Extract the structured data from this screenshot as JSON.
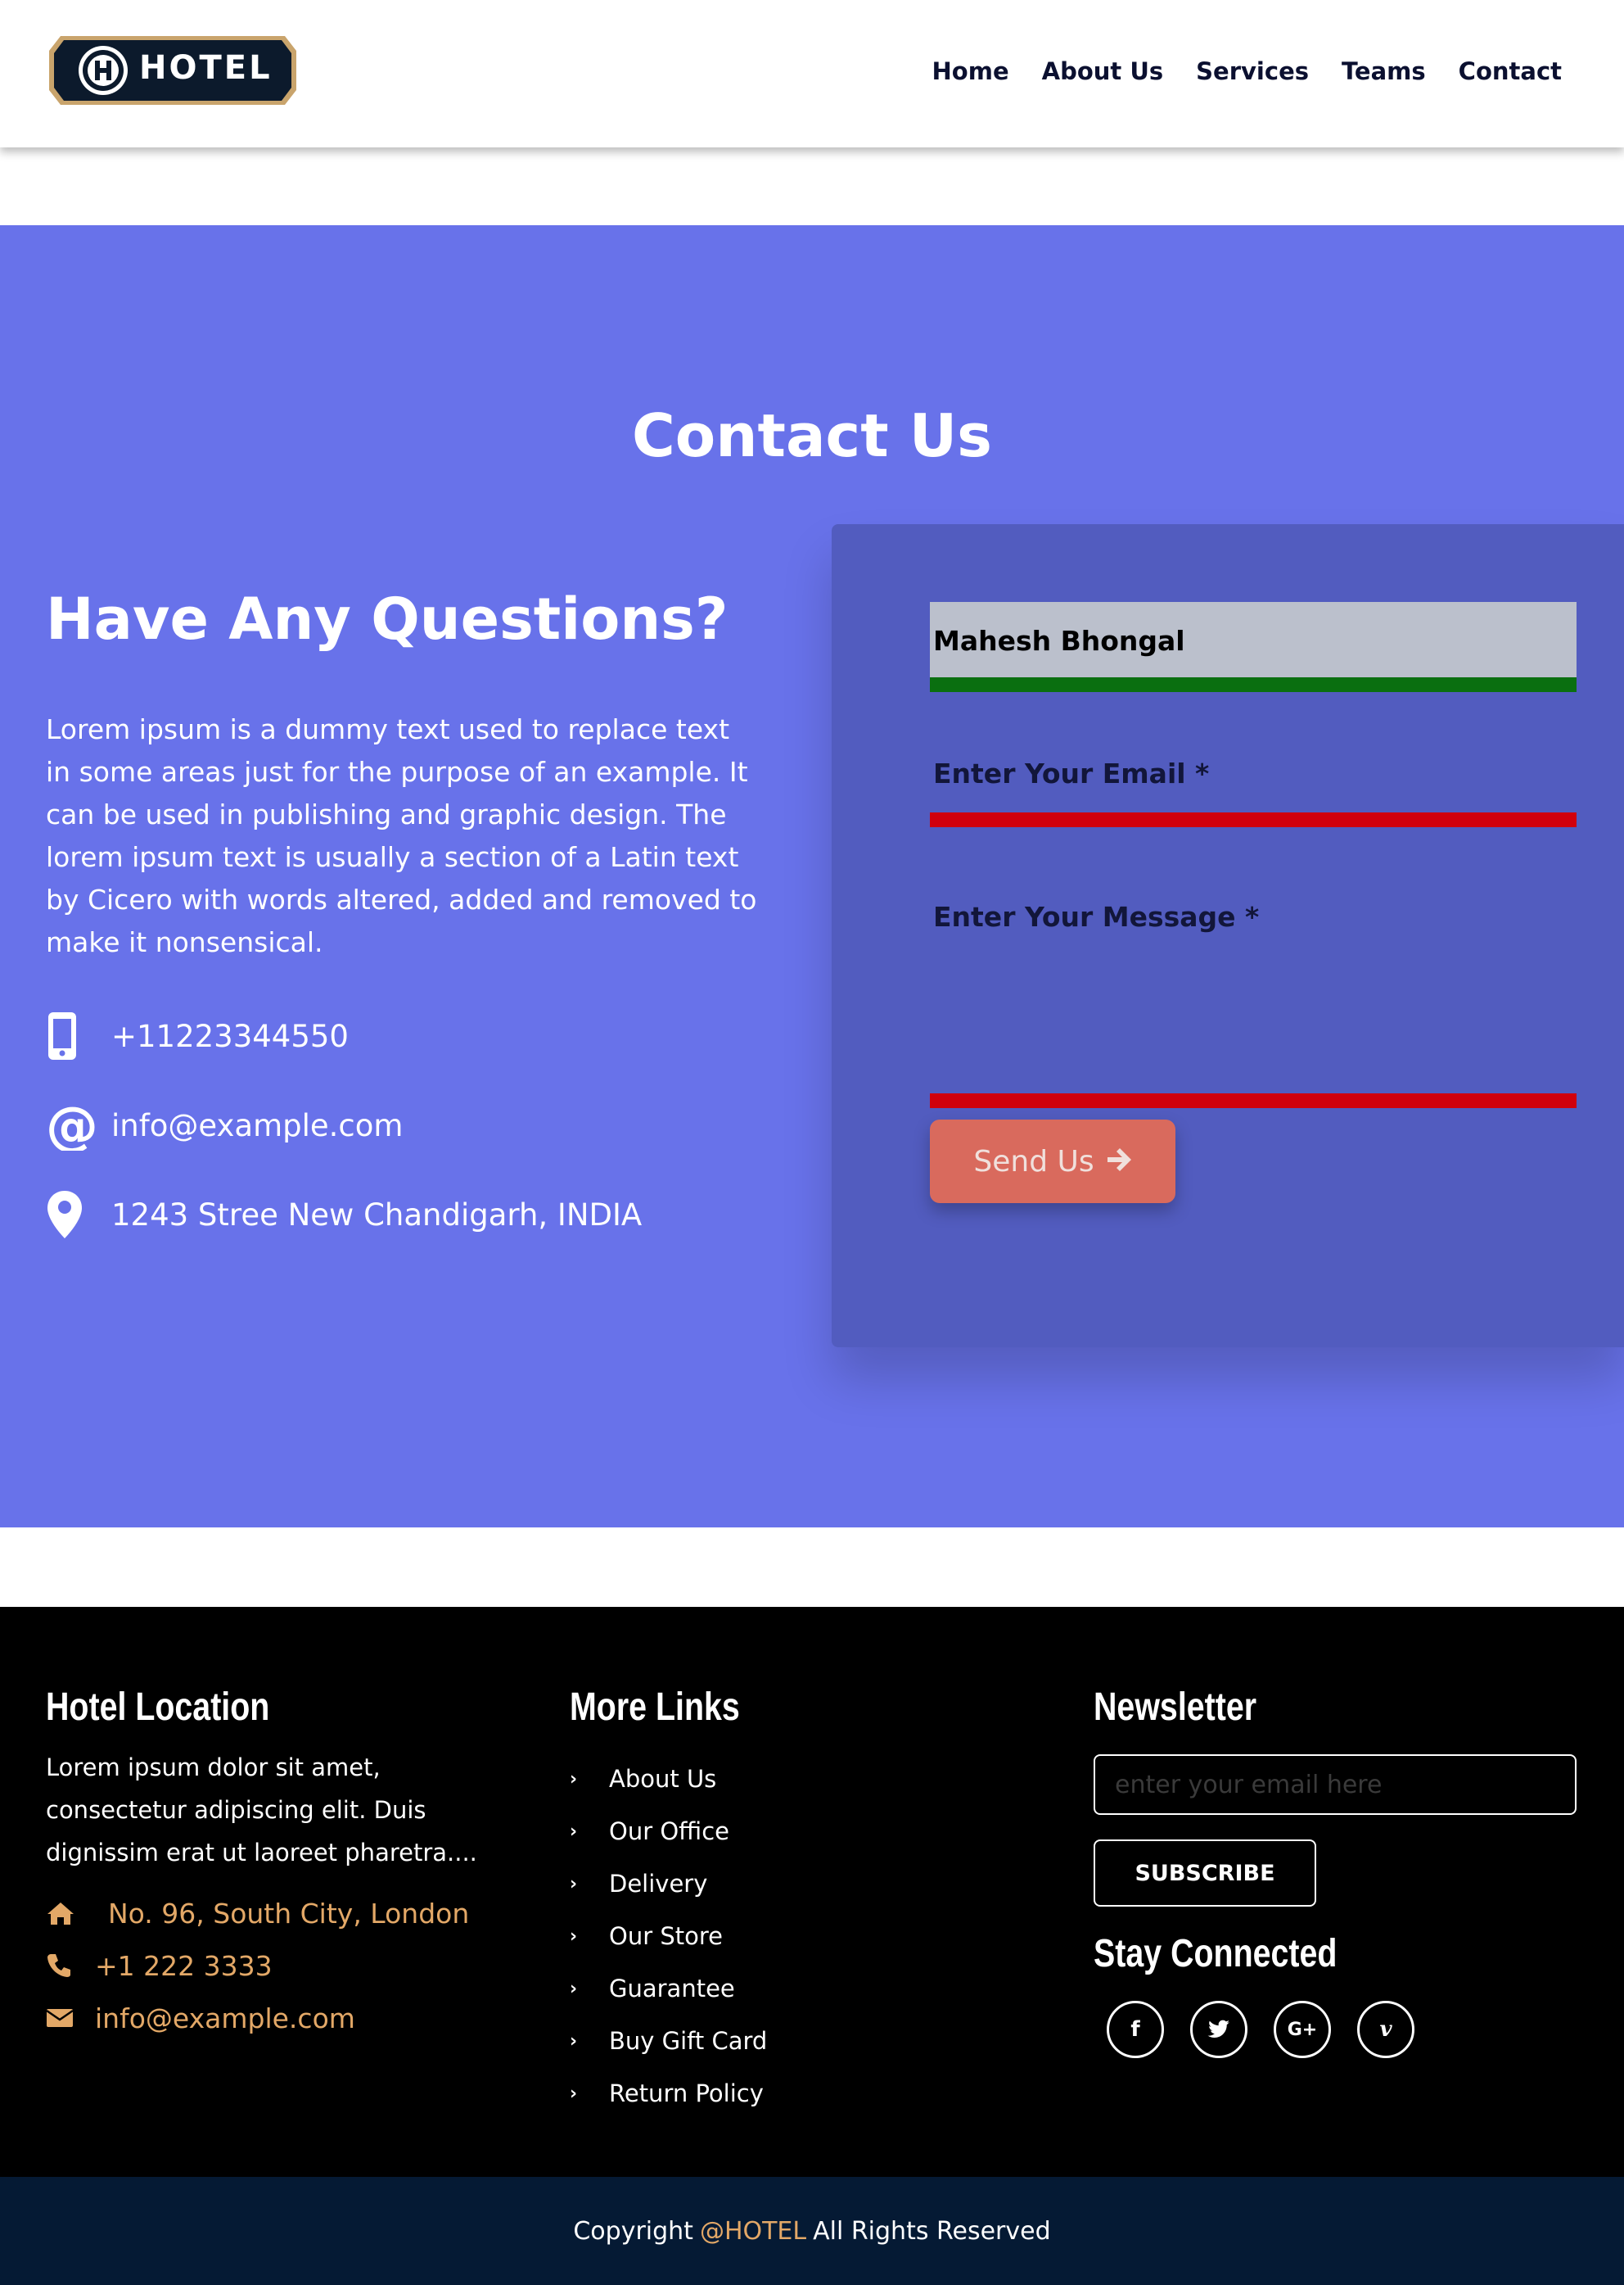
{
  "header": {
    "logo_text": "HOTEL",
    "nav": [
      "Home",
      "About Us",
      "Services",
      "Teams",
      "Contact"
    ]
  },
  "contact": {
    "title": "Contact Us",
    "heading": "Have Any Questions?",
    "description": "Lorem ipsum is a dummy text used to replace text in some areas just for the purpose of an example. It can be used in publishing and graphic design. The lorem ipsum text is usually a section of a Latin text by Cicero with words altered, added and removed to make it nonsensical.",
    "phone": "+11223344550",
    "email": "info@example.com",
    "address": "1243 Stree New Chandigarh, INDIA",
    "form": {
      "name_value": "Mahesh Bhongal",
      "email_label": "Enter Your Email *",
      "message_label": "Enter Your Message *",
      "send_label": "Send Us"
    }
  },
  "footer": {
    "location": {
      "heading": "Hotel Location",
      "text": "Lorem ipsum dolor sit amet, consectetur adipiscing elit. Duis dignissim erat ut laoreet pharetra....",
      "address": "No. 96, South City, London",
      "phone": "+1 222 3333",
      "email": "info@example.com"
    },
    "links": {
      "heading": "More Links",
      "items": [
        "About Us",
        "Our Office",
        "Delivery",
        "Our Store",
        "Guarantee",
        "Buy Gift Card",
        "Return Policy"
      ]
    },
    "newsletter": {
      "heading": "Newsletter",
      "placeholder": "enter your email here",
      "subscribe": "SUBSCRIBE",
      "stay_heading": "Stay Connected"
    }
  },
  "copyright": {
    "prefix": "Copyright",
    "brand": "@HOTEL",
    "suffix": "All Rights Reserved"
  },
  "colors": {
    "contact_bg": "#6872ea",
    "form_bg": "#525cbf",
    "accent": "#e3a867",
    "button": "#d96a5d",
    "invalid_line": "#d0000c",
    "valid_line": "#0a6f10"
  }
}
